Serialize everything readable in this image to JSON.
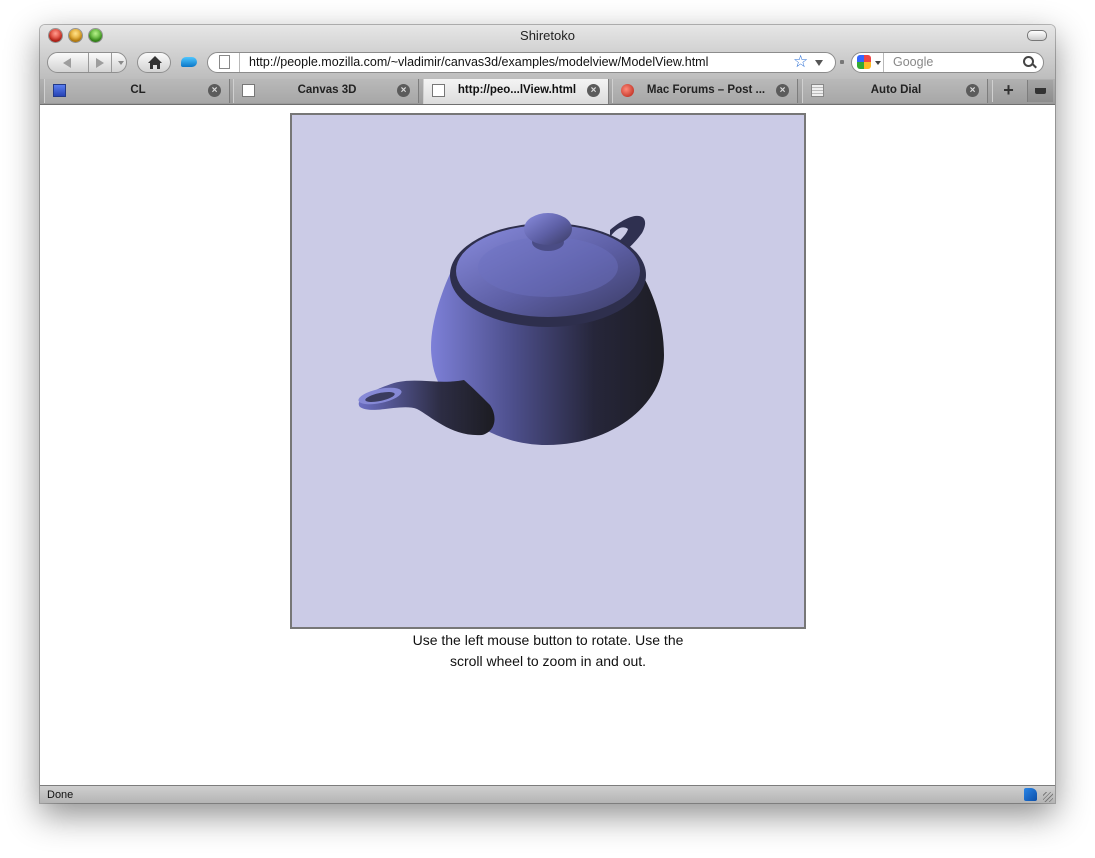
{
  "window": {
    "title": "Shiretoko"
  },
  "toolbar": {
    "url": "http://people.mozilla.com/~vladimir/canvas3d/examples/modelview/ModelView.html",
    "search_placeholder": "Google"
  },
  "tabs": [
    {
      "label": "CL",
      "favicon": "cl-icon",
      "active": false
    },
    {
      "label": "Canvas 3D",
      "favicon": "page-icon",
      "active": false
    },
    {
      "label": "http://peo...lView.html",
      "favicon": "page-icon",
      "active": true
    },
    {
      "label": "Mac Forums – Post ...",
      "favicon": "apple-icon",
      "active": false
    },
    {
      "label": "Auto Dial",
      "favicon": "dial-icon",
      "active": false
    }
  ],
  "page": {
    "instruction_line1": "Use the left mouse button to rotate. Use the",
    "instruction_line2": "scroll wheel to zoom in and out.",
    "canvas_bg": "#cbcbe6",
    "model_color": "#6b6fd0"
  },
  "status": {
    "text": "Done"
  },
  "icons": {
    "newtab": "+",
    "close": "×"
  }
}
